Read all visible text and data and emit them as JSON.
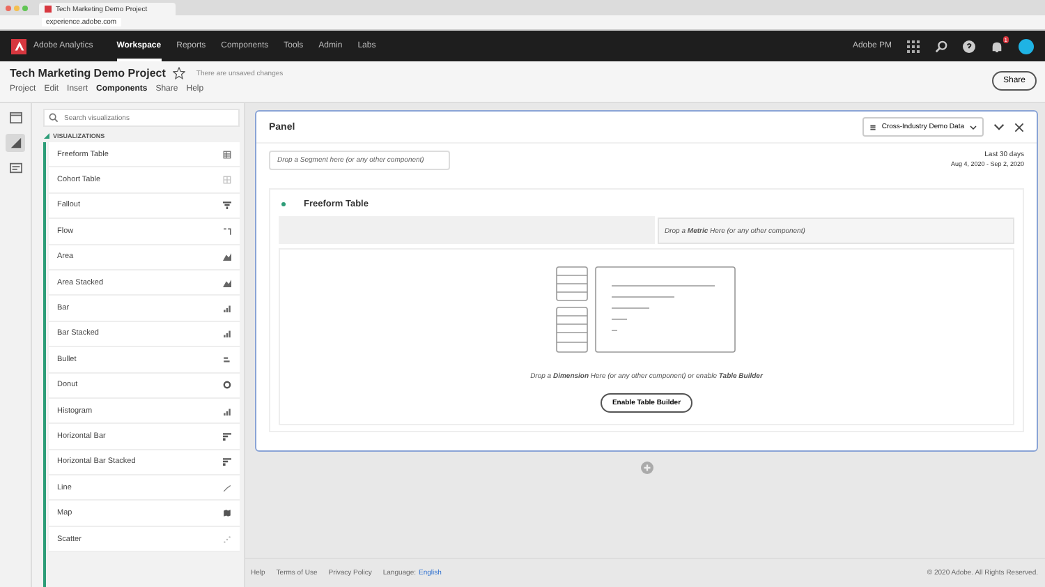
{
  "browser": {
    "tab_title": "Tech Marketing Demo Project",
    "url": "experience.adobe.com"
  },
  "nav": {
    "product": "Adobe Analytics",
    "items": [
      {
        "label": "Workspace",
        "selected": true
      },
      {
        "label": "Reports",
        "selected": false
      },
      {
        "label": "Components",
        "selected": false
      },
      {
        "label": "Tools",
        "selected": false
      },
      {
        "label": "Admin",
        "selected": false
      },
      {
        "label": "Labs",
        "selected": false
      }
    ],
    "org": "Adobe PM",
    "notification_count": "1"
  },
  "project": {
    "title": "Tech Marketing Demo Project",
    "status": "There are unsaved changes",
    "menu": [
      {
        "label": "Project",
        "selected": false
      },
      {
        "label": "Edit",
        "selected": false
      },
      {
        "label": "Insert",
        "selected": false
      },
      {
        "label": "Components",
        "selected": true
      },
      {
        "label": "Share",
        "selected": false
      },
      {
        "label": "Help",
        "selected": false
      }
    ],
    "share_button": "Share"
  },
  "rail": [
    {
      "kind": "panels",
      "selected": false
    },
    {
      "kind": "visualizations",
      "selected": true
    },
    {
      "kind": "components",
      "selected": false
    }
  ],
  "sidebar": {
    "search_placeholder": "Search visualizations",
    "section": "VISUALIZATIONS",
    "items": [
      {
        "label": "Freeform Table",
        "kind": "table"
      },
      {
        "label": "Cohort Table",
        "kind": "grid"
      },
      {
        "label": "Fallout",
        "kind": "funnel"
      },
      {
        "label": "Flow",
        "kind": "flow"
      },
      {
        "label": "Area",
        "kind": "area"
      },
      {
        "label": "Area Stacked",
        "kind": "area"
      },
      {
        "label": "Bar",
        "kind": "bar"
      },
      {
        "label": "Bar Stacked",
        "kind": "bar"
      },
      {
        "label": "Bullet",
        "kind": "bullet"
      },
      {
        "label": "Donut",
        "kind": "donut"
      },
      {
        "label": "Histogram",
        "kind": "bar"
      },
      {
        "label": "Horizontal Bar",
        "kind": "hbar"
      },
      {
        "label": "Horizontal Bar Stacked",
        "kind": "hbar"
      },
      {
        "label": "Line",
        "kind": "line"
      },
      {
        "label": "Map",
        "kind": "map"
      },
      {
        "label": "Scatter",
        "kind": "scatter"
      }
    ]
  },
  "panel": {
    "title": "Panel",
    "report_suite": "Cross-Industry Demo Data",
    "segment_drop": "Drop a Segment here (or any other component)",
    "date_range": "Last 30 days",
    "dates": "Aug 4, 2020 - Sep 2, 2020",
    "table": {
      "title": "Freeform Table",
      "metric_drop": "Drop a **Metric** Here (or any other component)",
      "dimension_drop": "Drop a **Dimension** Here (or any other component) or enable **Table Builder**",
      "builder_button": "Enable Table Builder"
    }
  },
  "footer": {
    "links": [
      "Help",
      "Terms of Use",
      "Privacy Policy"
    ],
    "language_label": "Language:",
    "language": "English",
    "copyright": "© 2020 Adobe. All Rights Reserved."
  }
}
